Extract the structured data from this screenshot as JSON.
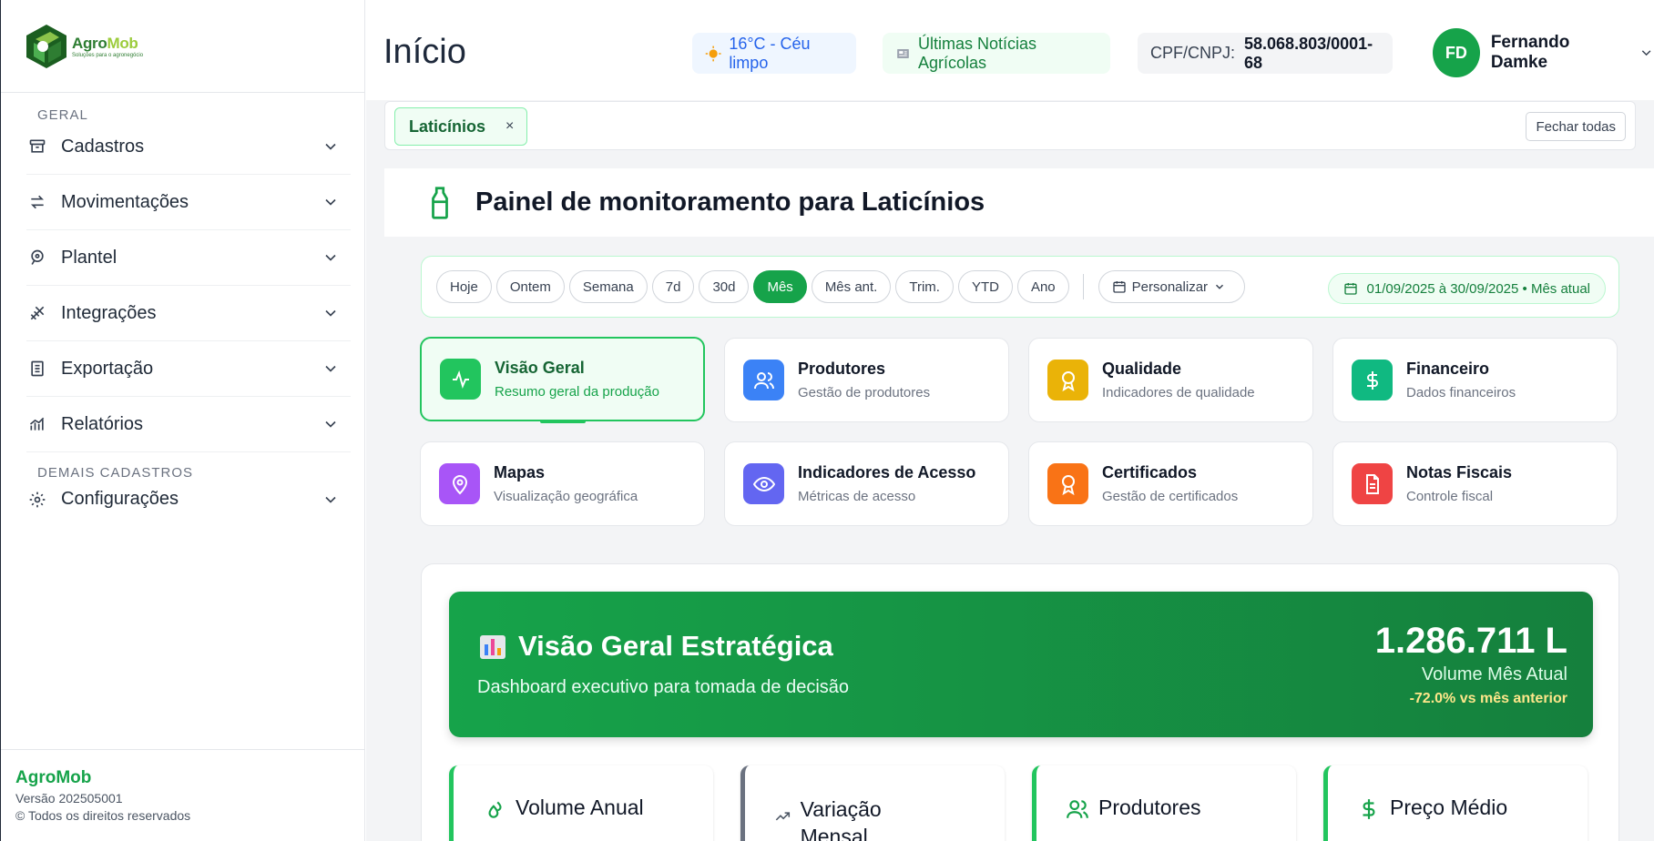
{
  "app": {
    "name_part1": "Agro",
    "name_part2": "Mob",
    "tagline": "Soluções para o agronegócio"
  },
  "sidebar": {
    "section_general": "GERAL",
    "section_other": "DEMAIS CADASTROS",
    "items": [
      {
        "label": "Cadastros",
        "icon": "archive-icon"
      },
      {
        "label": "Movimentações",
        "icon": "arrows-icon"
      },
      {
        "label": "Plantel",
        "icon": "tag-icon"
      },
      {
        "label": "Integrações",
        "icon": "dna-icon"
      },
      {
        "label": "Exportação",
        "icon": "document-icon"
      },
      {
        "label": "Relatórios",
        "icon": "chart-icon"
      },
      {
        "label": "Configurações",
        "icon": "gear-icon"
      }
    ],
    "footer": {
      "brand": "AgroMob",
      "version": "Versão 202505001",
      "copyright": "© Todos os direitos reservados"
    }
  },
  "header": {
    "title": "Início",
    "weather": "16°C - Céu limpo",
    "news": "Últimas Notícias Agrícolas",
    "cpf_label": "CPF/CNPJ:",
    "cpf_value": "58.068.803/0001-68",
    "user_initials": "FD",
    "user_name": "Fernando Damke"
  },
  "tabs": {
    "open": [
      {
        "label": "Laticínios",
        "close": "×"
      }
    ],
    "close_all": "Fechar todas"
  },
  "panel": {
    "title": "Painel de monitoramento para Laticínios"
  },
  "filters": {
    "periods": [
      "Hoje",
      "Ontem",
      "Semana",
      "7d",
      "30d",
      "Mês",
      "Mês ant.",
      "Trim.",
      "YTD",
      "Ano"
    ],
    "active": "Mês",
    "custom": "Personalizar",
    "range": "01/09/2025 à 30/09/2025 • Mês atual"
  },
  "cards": [
    {
      "title": "Visão Geral",
      "subtitle": "Resumo geral da produção",
      "color": "#22c55e",
      "icon": "activity-icon"
    },
    {
      "title": "Produtores",
      "subtitle": "Gestão de produtores",
      "color": "#3b82f6",
      "icon": "users-icon"
    },
    {
      "title": "Qualidade",
      "subtitle": "Indicadores de qualidade",
      "color": "#eab308",
      "icon": "award-icon"
    },
    {
      "title": "Financeiro",
      "subtitle": "Dados financeiros",
      "color": "#10b981",
      "icon": "dollar-icon"
    },
    {
      "title": "Mapas",
      "subtitle": "Visualização geográfica",
      "color": "#a855f7",
      "icon": "map-pin-icon"
    },
    {
      "title": "Indicadores de Acesso",
      "subtitle": "Métricas de acesso",
      "color": "#6366f1",
      "icon": "eye-icon"
    },
    {
      "title": "Certificados",
      "subtitle": "Gestão de certificados",
      "color": "#f97316",
      "icon": "award-icon"
    },
    {
      "title": "Notas Fiscais",
      "subtitle": "Controle fiscal",
      "color": "#ef4444",
      "icon": "file-icon"
    }
  ],
  "hero": {
    "title": "Visão Geral Estratégica",
    "subtitle": "Dashboard executivo para tomada de decisão",
    "value": "1.286.711 L",
    "value_label": "Volume Mês Atual",
    "change": "-72.0% vs mês anterior"
  },
  "kpis": [
    {
      "title": "Volume Anual"
    },
    {
      "title": "Variação Mensal"
    },
    {
      "title": "Produtores"
    },
    {
      "title": "Preço Médio"
    }
  ]
}
